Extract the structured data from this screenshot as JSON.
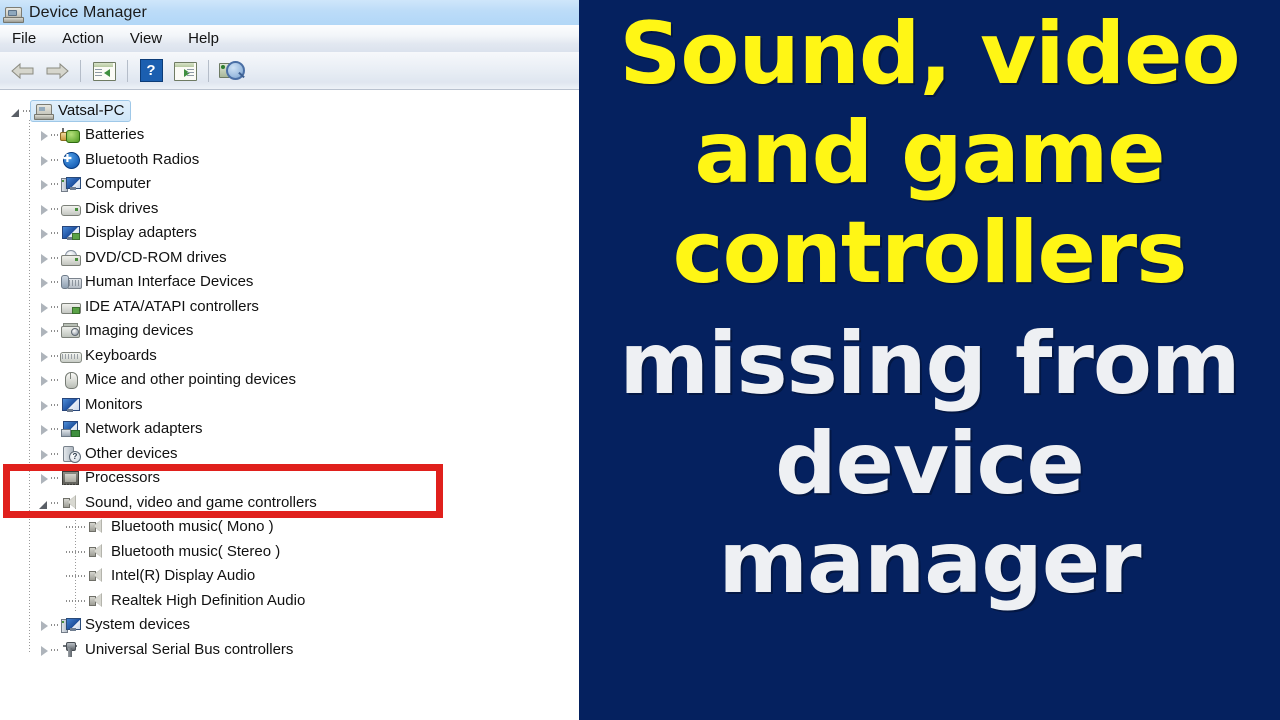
{
  "window": {
    "title": "Device Manager",
    "title_icon": "device-manager-icon",
    "menu": [
      {
        "label": "File"
      },
      {
        "label": "Action"
      },
      {
        "label": "View"
      },
      {
        "label": "Help"
      }
    ],
    "toolbar": [
      {
        "icon": "back-arrow-icon",
        "label": "Back"
      },
      {
        "icon": "forward-arrow-icon",
        "label": "Forward"
      },
      {
        "icon": "show-console-tree-icon",
        "label": "Show/Hide Console Tree"
      },
      {
        "icon": "help-icon",
        "label": "Help"
      },
      {
        "icon": "properties-icon",
        "label": "Properties"
      },
      {
        "icon": "scan-hardware-changes-icon",
        "label": "Scan for hardware changes"
      }
    ]
  },
  "tree": {
    "root": {
      "label": "Vatsal-PC",
      "icon": "computer-icon",
      "expanded": true,
      "selected": true
    },
    "nodes": [
      {
        "label": "Batteries",
        "icon": "battery-icon",
        "expanded": false
      },
      {
        "label": "Bluetooth Radios",
        "icon": "bluetooth-icon",
        "expanded": false
      },
      {
        "label": "Computer",
        "icon": "computer-node-icon",
        "expanded": false
      },
      {
        "label": "Disk drives",
        "icon": "disk-drive-icon",
        "expanded": false
      },
      {
        "label": "Display adapters",
        "icon": "display-adapter-icon",
        "expanded": false
      },
      {
        "label": "DVD/CD-ROM drives",
        "icon": "dvd-drive-icon",
        "expanded": false
      },
      {
        "label": "Human Interface Devices",
        "icon": "hid-icon",
        "expanded": false
      },
      {
        "label": "IDE ATA/ATAPI controllers",
        "icon": "ide-controller-icon",
        "expanded": false
      },
      {
        "label": "Imaging devices",
        "icon": "imaging-device-icon",
        "expanded": false
      },
      {
        "label": "Keyboards",
        "icon": "keyboard-icon",
        "expanded": false
      },
      {
        "label": "Mice and other pointing devices",
        "icon": "mouse-icon",
        "expanded": false
      },
      {
        "label": "Monitors",
        "icon": "monitor-icon",
        "expanded": false
      },
      {
        "label": "Network adapters",
        "icon": "network-adapter-icon",
        "expanded": false
      },
      {
        "label": "Other devices",
        "icon": "other-devices-icon",
        "expanded": false
      },
      {
        "label": "Processors",
        "icon": "processor-icon",
        "expanded": false
      },
      {
        "label": "Sound, video and game controllers",
        "icon": "sound-controller-icon",
        "expanded": true
      },
      {
        "label": "System devices",
        "icon": "system-device-icon",
        "expanded": false
      },
      {
        "label": "Universal Serial Bus controllers",
        "icon": "usb-controller-icon",
        "expanded": false
      }
    ],
    "sound_children": [
      {
        "label": "Bluetooth music( Mono )",
        "icon": "speaker-icon"
      },
      {
        "label": "Bluetooth music( Stereo )",
        "icon": "speaker-icon"
      },
      {
        "label": "Intel(R) Display Audio",
        "icon": "speaker-icon"
      },
      {
        "label": "Realtek High Definition Audio",
        "icon": "speaker-icon"
      }
    ]
  },
  "annotation": {
    "highlight_color": "#e0201c",
    "highlight_target": "Sound, video and game controllers"
  },
  "card": {
    "background_color": "#05215f",
    "accent_yellow": "#fff615",
    "accent_white": "#eef0f3",
    "lines": [
      {
        "text": "Sound, video",
        "color": "yellow"
      },
      {
        "text": "and game",
        "color": "yellow"
      },
      {
        "text": "controllers",
        "color": "yellow"
      },
      {
        "text": "missing from",
        "color": "white"
      },
      {
        "text": "device",
        "color": "white"
      },
      {
        "text": "manager",
        "color": "white"
      }
    ]
  }
}
